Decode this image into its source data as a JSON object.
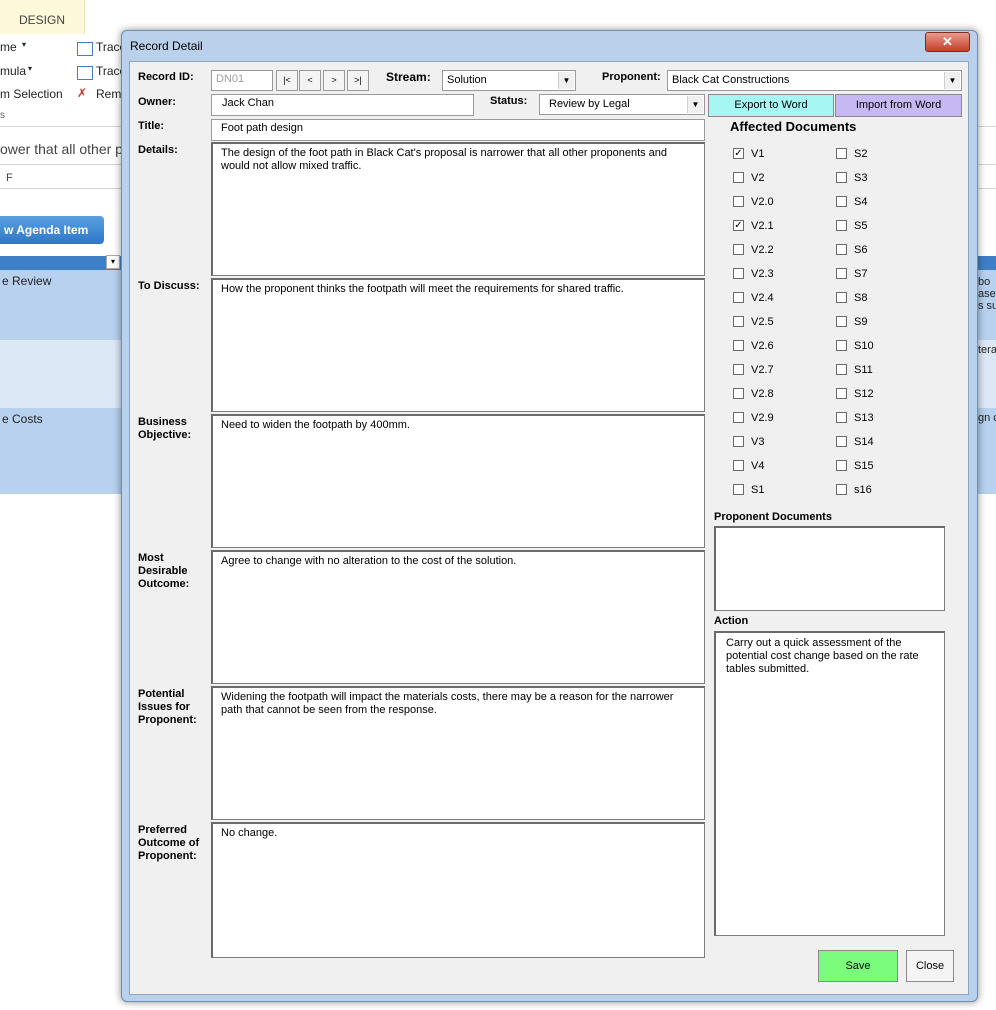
{
  "bg": {
    "tab": "DESIGN",
    "ribbon": [
      "me",
      "mula",
      "m Selection",
      "Trace",
      "Trace",
      "Remo"
    ],
    "formula_text": "ower that all other pr",
    "col_letter": "F",
    "agenda_button": "w Agenda Item",
    "rows": [
      "e Review",
      "e Costs"
    ],
    "right_frag": [
      "bo",
      "ase",
      "s su",
      "tera",
      "gn c"
    ]
  },
  "dialog": {
    "title": "Record Detail",
    "close_glyph": "✕",
    "labels": {
      "record_id": "Record ID:",
      "stream": "Stream:",
      "proponent": "Proponent:",
      "owner": "Owner:",
      "status": "Status:",
      "title": "Title:",
      "details": "Details:",
      "to_discuss": "To Discuss:",
      "business_objective": "Business Objective:",
      "most_desirable": "Most Desirable Outcome:",
      "potential_issues": "Potential Issues for Proponent:",
      "preferred_outcome": "Preferred Outcome of Proponent:"
    },
    "record_id": "DN01",
    "nav": [
      "|<",
      "<",
      ">",
      ">|"
    ],
    "stream": "Solution",
    "proponent": "Black Cat Constructions",
    "owner": "Jack Chan",
    "status": "Review by Legal",
    "title_value": "Foot path design",
    "details": "The design of the foot path in Black Cat's proposal is narrower that all other proponents and would not allow mixed traffic.",
    "to_discuss": "How the proponent thinks the footpath will meet the requirements for shared traffic.",
    "business_objective": "Need to widen the footpath by 400mm.",
    "most_desirable": "Agree to change with no alteration to the cost of the solution.",
    "potential_issues": "Widening the footpath will impact the materials costs, there may be a reason for the narrower path that cannot be seen from the response.",
    "preferred_outcome": "No change.",
    "export_button": "Export to Word",
    "import_button": "Import from Word",
    "affected_docs_title": "Affected Documents",
    "docs_left": [
      {
        "label": "V1",
        "checked": true
      },
      {
        "label": "V2",
        "checked": false
      },
      {
        "label": "V2.0",
        "checked": false
      },
      {
        "label": "V2.1",
        "checked": true
      },
      {
        "label": "V2.2",
        "checked": false
      },
      {
        "label": "V2.3",
        "checked": false
      },
      {
        "label": "V2.4",
        "checked": false
      },
      {
        "label": "V2.5",
        "checked": false
      },
      {
        "label": "V2.6",
        "checked": false
      },
      {
        "label": "V2.7",
        "checked": false
      },
      {
        "label": "V2.8",
        "checked": false
      },
      {
        "label": "V2.9",
        "checked": false
      },
      {
        "label": "V3",
        "checked": false
      },
      {
        "label": "V4",
        "checked": false
      },
      {
        "label": "S1",
        "checked": false
      }
    ],
    "docs_right": [
      {
        "label": "S2",
        "checked": false
      },
      {
        "label": "S3",
        "checked": false
      },
      {
        "label": "S4",
        "checked": false
      },
      {
        "label": "S5",
        "checked": false
      },
      {
        "label": "S6",
        "checked": false
      },
      {
        "label": "S7",
        "checked": false
      },
      {
        "label": "S8",
        "checked": false
      },
      {
        "label": "S9",
        "checked": false
      },
      {
        "label": "S10",
        "checked": false
      },
      {
        "label": "S11",
        "checked": false
      },
      {
        "label": "S12",
        "checked": false
      },
      {
        "label": "S13",
        "checked": false
      },
      {
        "label": "S14",
        "checked": false
      },
      {
        "label": "S15",
        "checked": false
      },
      {
        "label": "s16",
        "checked": false
      }
    ],
    "proponent_docs_title": "Proponent Documents",
    "proponent_docs_value": "",
    "action_title": "Action",
    "action_value": "Carry out a quick assessment of the potential cost change based on the rate tables submitted.",
    "save_button": "Save",
    "close_button": "Close",
    "colors": {
      "save": "#7cfc7c",
      "export": "#a6f6f4",
      "import": "#c7b8f4"
    }
  }
}
